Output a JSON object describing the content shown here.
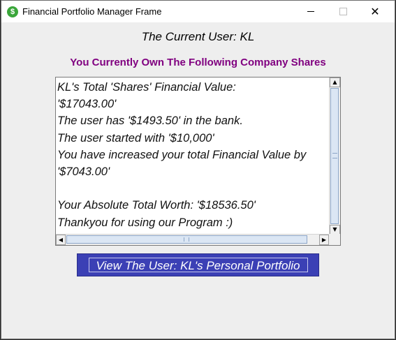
{
  "window": {
    "title": "Financial Portfolio Manager Frame",
    "app_icon_glyph": "$",
    "close_glyph": "✕"
  },
  "header": {
    "current_user": "The Current User: KL",
    "subheading": "You Currently Own The Following Company Shares"
  },
  "report": {
    "text": "KL's Total 'Shares' Financial Value:\n'$17043.00'\nThe user has '$1493.50' in the bank.\nThe user started with '$10,000'\nYou have increased your total Financial Value by\n'$7043.00'\n\nYour Absolute Total Worth: '$18536.50'\nThankyou for using our Program :)"
  },
  "scrollbar": {
    "up_glyph": "▲",
    "down_glyph": "▼",
    "left_glyph": "◀",
    "right_glyph": "▶"
  },
  "actions": {
    "view_portfolio_label": "View The User: KL's Personal Portfolio"
  },
  "colors": {
    "subheading": "#800080",
    "button_bg": "#3b40b5",
    "app_icon": "#3aa63a"
  }
}
